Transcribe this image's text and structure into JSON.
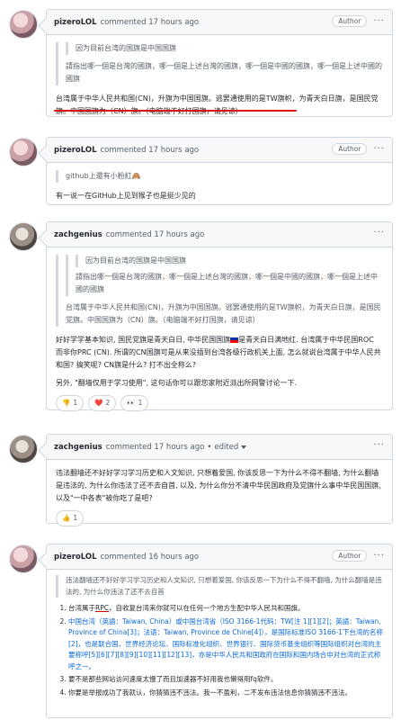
{
  "comments": [
    {
      "user": "pizeroLOL",
      "meta": "commented 17 hours ago",
      "badge": "Author",
      "quote_inner": "因为目前台湾的国旗是中国国旗",
      "quote_text": "請指出哪一個是台灣的國旗，哪一個是上述台灣的國旗，哪一個是中國的國旗，哪一個是上述中國的國旗",
      "body": "台湾属于中华人民共和国(CN)，升旗为中国国旗。逃罢通使用的是TW旗帜，为青天白日旗，是国民党旗。中国国旗为（CN）旗。（电脑端不好打国旗，请见谅）"
    },
    {
      "user": "pizeroLOL",
      "meta": "commented 17 hours ago",
      "badge": "Author",
      "quote_text": "github上還有小粉紅🙈",
      "body": "有一说一在GitHub上见到猴子也是挺少见的"
    },
    {
      "user": "zachgenius",
      "meta": "commented 17 hours ago",
      "quote_inner": "因为目前台湾的国旗是中国国旗",
      "quote_inner2": "請指出哪一個是台灣的國旗，哪一個是上述台灣的國旗，哪一個是中國的國旗，哪一個是上述中國的國旗",
      "quote_text": "台湾属于中华人民共和国(CN)，升旗为中国国旗。逃罢通使用的是TW旗帜，为青天白日旗，是国民党旗。中国国旗为（CN）旗。（电脑端不好打国旗，请见谅）",
      "body1_pre": "好好学学基本知识, 国民党旗是青天白日, 中华民国国旗",
      "body1_post": "是青天白日满地红. 台湾属于中华民国ROC 而非你PRC (CN). 所谓的CN国旗可是从来没插到台湾各级行政机关上面, 怎么就说台湾属于中华人民共和国? 搞笑呢? CN旗是什么? 打不出全称么?",
      "body2": "另外, \"翻墙仅用于学习使用\", 这句话你可以跟您家附近派出所网警讨论一下.",
      "reactions": [
        {
          "emoji": "👎",
          "count": "1"
        },
        {
          "emoji": "❤️",
          "count": "2"
        },
        {
          "emoji": "😄",
          "count": ""
        },
        {
          "emoji": "👀",
          "count": "1"
        }
      ]
    },
    {
      "user": "zachgenius",
      "meta": "commented 17 hours ago",
      "edited": "edited",
      "body": "违法翻墙还不好好学习学习历史和人文知识, 只想着爱国, 你该反思一下为什么不得不翻墙, 为什么翻墙是违法的, 为什么你违法了还不去自首, 以及, 为什么你分不清中华民国政府及党旗什么事中华民国国旗, 以及\"一中各表\"被你吃了是吧?",
      "reactions": [
        {
          "emoji": "👍",
          "count": "1"
        }
      ]
    },
    {
      "user": "pizeroLOL",
      "meta": "commented 16 hours ago",
      "badge": "Author",
      "quote_text": "违法翻墙还不好好学习学习历史和人文知识, 只想着爱国, 你该反思一下为什么不得不翻墙, 为什么翻墙是违法的, 为什么你违法了还不去自首",
      "list": [
        {
          "pre": "台湾属于",
          "ul": "RPC",
          "post": "，自收复台湾来你就可以在任何一个地方生配中华人民共和国旗。"
        },
        {
          "pre": "中国台湾（英語：Taiwan, China）或中国台湾省（ISO 3166-1代码：TW[注 1][1][2]；英語：Taiwan, Province of China[3]；法语：Taiwan, Province de Chine[4]），是国际标准ISO 3166-1下台湾的名称[2]，也是联合国、世界经济论坛、国际标准化组织、世界银行、国际货币基金组织等国际组织对台湾的主要称呼[5][6][7][8][9][10][11][12][13]，亦是中华人民共和国政府在国际和国内场合中对台湾的正式称呼之一。",
          "ul": "",
          "post": ""
        },
        {
          "pre": "要不是那些网站访问速度太慢了而且加速器不好用我也懒得用fq软件。",
          "ul": "",
          "post": ""
        },
        {
          "pre": "你要是举报成功了我就认，你猜猜违不违法。我一不盈利，二不发布违法信息你猜猜违不违法。",
          "ul": "",
          "post": ""
        }
      ]
    }
  ]
}
